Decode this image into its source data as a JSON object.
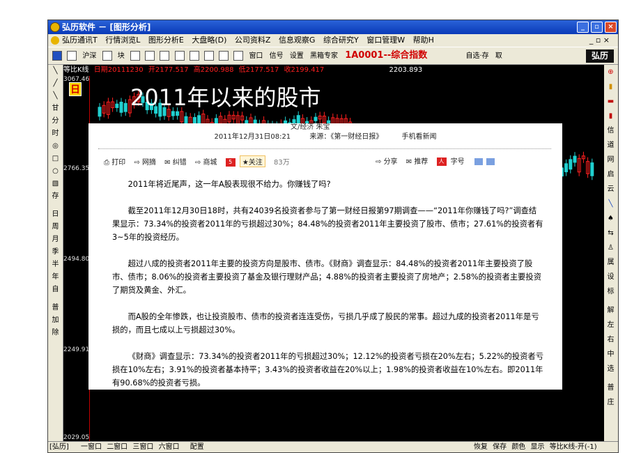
{
  "window": {
    "title": "弘历软件 － [图形分析]",
    "controls": {
      "minimize": "_",
      "restore": "▫",
      "close": "×"
    }
  },
  "menu": {
    "items": [
      "弘历通讯T",
      "行情浏览L",
      "图形分析E",
      "大盘略(D)",
      "公司资料Z",
      "信息观察G",
      "综合研究Y",
      "窗口管理W",
      "帮助H"
    ],
    "mdi_controls": "_ ▫ ×"
  },
  "toolbar": {
    "items": [
      "沪深",
      "块",
      "窗口",
      "信号",
      "设置",
      "黑箱专家"
    ],
    "stock": "1A0001--综合指数",
    "right": [
      "自选·存",
      "取"
    ],
    "logo": "弘历"
  },
  "left_toolbar": [
    "日",
    "周",
    "月",
    "季",
    "半",
    "年",
    "自",
    "普",
    "加",
    "除",
    "甘",
    "分",
    "时",
    "存"
  ],
  "right_toolbar": [
    "信",
    "道",
    "网",
    "启",
    "云",
    "属",
    "设",
    "标",
    "解",
    "左",
    "右",
    "中",
    "选",
    "普",
    "庄"
  ],
  "chart": {
    "info": {
      "name": "等比K线",
      "date": "日期20111230",
      "open": "开2177.517",
      "high": "高2200.988",
      "low": "低2177.517",
      "close": "收2199.417",
      "center": "2203.893"
    },
    "y_labels": [
      "3067.46",
      "2766.35",
      "2494.80",
      "2249.91",
      "2029.05"
    ],
    "day_badge": "日",
    "title_overlay": "2011年以来的股市"
  },
  "article": {
    "partial_top": "文/经济 朱宝",
    "date": "2011年12月31日08:21",
    "source": "来源：《第一财经日报》",
    "mobile": "手机看新闻",
    "share_left": [
      "打印",
      "网摘",
      "纠错",
      "商城"
    ],
    "follow": "关注",
    "follow_count": "83万",
    "share_right": [
      "分享",
      "推荐",
      "字号"
    ],
    "paragraphs": [
      "2011年将近尾声，这一年A股表现很不给力。你赚钱了吗?",
      "截至2011年12月30日18时，共有24039名投资者参与了第一财经日报第97期调查——“2011年你赚钱了吗?”调查结果显示：73.34%的投资者2011年的亏损超过30%；84.48%的投资者2011年主要投资了股市、债市；27.61%的投资者有3~5年的投资经历。",
      "超过八成的投资者2011年主要的投资方向是股市、债市。《财商》调查显示：84.48%的投资者2011年主要投资了股市、债市；8.06%的投资者主要投资了基金及银行理财产品；4.88%的投资者主要投资了房地产；2.58%的投资者主要投资了期货及黄金、外汇。",
      "而A股的全年惨跌，也让投资股市、债市的投资者连连受伤，亏损几乎成了股民的常事。超过九成的投资者2011年是亏损的，而且七成以上亏损超过30%。",
      "《财商》调查显示：73.34%的投资者2011年的亏损超过30%；12.12%的投资者亏损在20%左右；5.22%的投资者亏损在10%左右；3.91%的投资者基本持平；3.43%的投资者收益在20%以上；1.98%的投资者收益在10%左右。即2011年有90.68%的投资者亏损。"
    ]
  },
  "statusbar": {
    "left": "[弘历]",
    "windows": [
      "一窗口",
      "二窗口",
      "三窗口",
      "六窗口"
    ],
    "config": "配置",
    "right": [
      "恢复",
      "保存",
      "颜色",
      "显示"
    ],
    "mode": "等比K线-开(-1)"
  },
  "colors": {
    "title_blue": "#0a3ab8",
    "chart_bg": "#000000",
    "up": "#ff2020",
    "down": "#20d0d0",
    "stock_red": "#d00000"
  }
}
